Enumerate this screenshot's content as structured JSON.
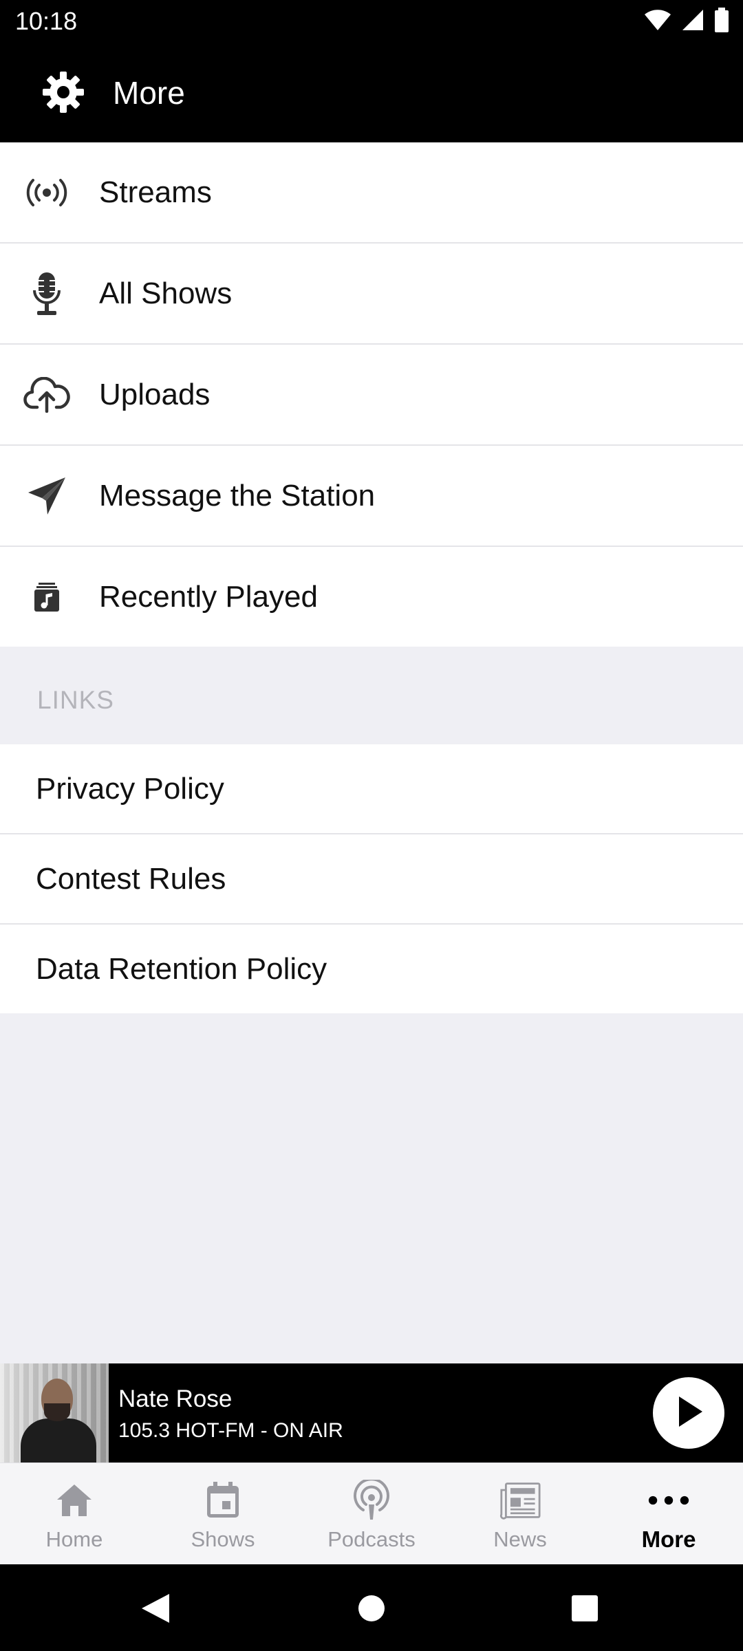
{
  "status_bar": {
    "time": "10:18",
    "icons": [
      "wifi-icon",
      "signal-icon",
      "battery-icon"
    ]
  },
  "app_bar": {
    "title": "More",
    "icon": "gear-icon"
  },
  "menu": {
    "items": [
      {
        "label": "Streams",
        "icon": "broadcast-icon"
      },
      {
        "label": "All Shows",
        "icon": "microphone-icon"
      },
      {
        "label": "Uploads",
        "icon": "cloud-upload-icon"
      },
      {
        "label": "Message the Station",
        "icon": "paper-plane-icon"
      },
      {
        "label": "Recently Played",
        "icon": "music-note-icon"
      }
    ]
  },
  "links_section": {
    "header": "LINKS",
    "items": [
      {
        "label": "Privacy Policy"
      },
      {
        "label": "Contest Rules"
      },
      {
        "label": "Data Retention Policy"
      }
    ]
  },
  "player": {
    "title": "Nate Rose",
    "subtitle": "105.3 HOT-FM - ON AIR",
    "play_icon": "play-icon"
  },
  "tab_bar": {
    "tabs": [
      {
        "label": "Home",
        "icon": "home-icon",
        "active": false
      },
      {
        "label": "Shows",
        "icon": "calendar-icon",
        "active": false
      },
      {
        "label": "Podcasts",
        "icon": "podcast-icon",
        "active": false
      },
      {
        "label": "News",
        "icon": "newspaper-icon",
        "active": false
      },
      {
        "label": "More",
        "icon": "more-dots-icon",
        "active": true
      }
    ]
  },
  "colors": {
    "header_bg": "#000000",
    "page_bg": "#efeff4",
    "active_tab": "#000000",
    "inactive_tab": "#9a9aa0"
  }
}
